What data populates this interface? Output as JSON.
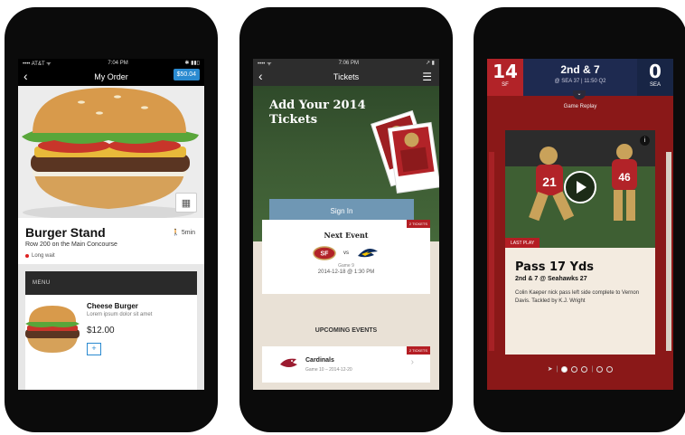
{
  "phone1": {
    "status": {
      "carrier": "•••• AT&T ᯤ",
      "time": "7:04 PM",
      "battery": "✱ ▮▮▯"
    },
    "nav": {
      "title": "My Order",
      "price_button": "$50.04"
    },
    "stand": {
      "name": "Burger Stand",
      "location": "Row 200 on the Main Concourse",
      "walk_time": "5min",
      "wait_status": "Long wait"
    },
    "menu": {
      "header": "MENU",
      "item": {
        "name": "Cheese Burger",
        "description": "Lorem ipsum dolor sit amet",
        "price": "$12.00",
        "add_label": "+"
      }
    }
  },
  "phone2": {
    "status": {
      "carrier": "•••• ᯤ",
      "time": "7:06 PM",
      "battery": "↗ ▮"
    },
    "nav": {
      "title": "Tickets"
    },
    "promo": {
      "title": "Add Your 2014 Tickets",
      "signin_label": "Sign In"
    },
    "next_event": {
      "badge": "2 TICKETS",
      "title": "Next Event",
      "vs": "vs",
      "game": "Game 9",
      "date": "2014-12-18 @ 1:30 PM"
    },
    "upcoming": {
      "title": "UPCOMING EVENTS",
      "badge": "2 TICKETS",
      "team": "Cardinals",
      "game_date": "Game 10 – 2014-12-20"
    }
  },
  "phone3": {
    "score": {
      "home_score": "14",
      "home_team": "SF",
      "away_score": "0",
      "away_team": "SEA",
      "down": "2nd & 7",
      "position": "@ SEA 37  |  11:50 Q2"
    },
    "replay_label": "Game Replay",
    "play": {
      "badge": "LAST PLAY",
      "title": "Pass 17 Yds",
      "subtitle": "2nd & 7 @ Seahawks 27",
      "description": "Colin Kaeper nick pass left side complete to Vernon Davis. Tackled by K.J. Wright"
    },
    "info_label": "i"
  },
  "colors": {
    "order_blue": "#2a8ad0",
    "ticket_red": "#b41e24",
    "niners_red": "#b22328",
    "seahawks_navy": "#182545",
    "field_green": "#3c5a33"
  }
}
